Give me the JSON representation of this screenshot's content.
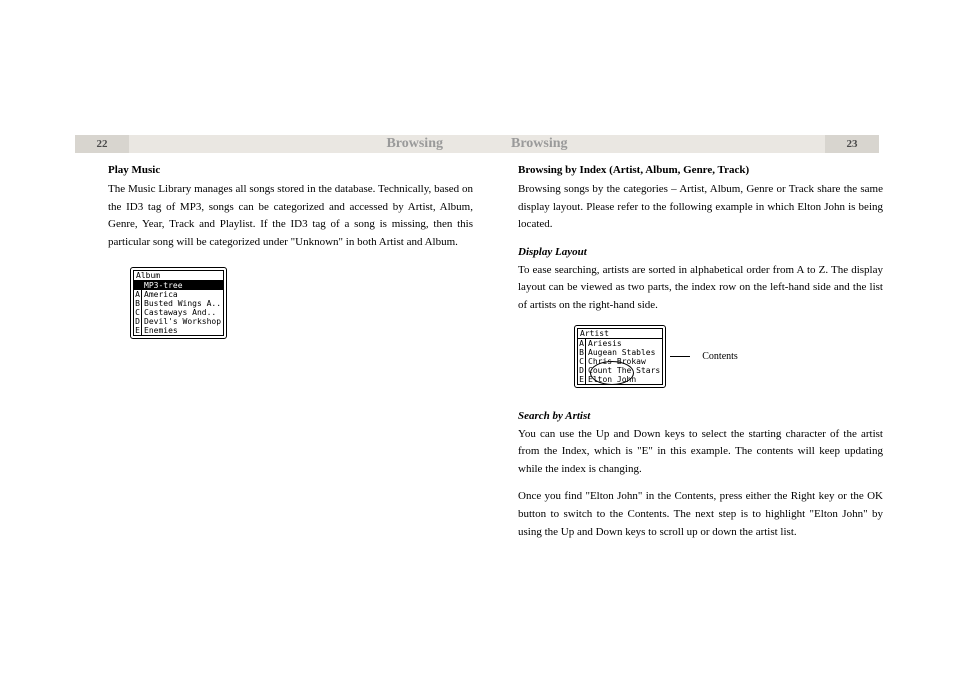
{
  "header": {
    "left_page_number": "22",
    "left_title": "Browsing",
    "right_title": "Browsing",
    "right_page_number": "23"
  },
  "left": {
    "heading": "Play Music",
    "p1": "The Music Library manages all songs stored in the database. Technically, based on the ID3 tag of MP3, songs can be categorized and accessed by Artist, Album, Genre, Year, Track and Playlist.  If the ID3 tag of  a song is missing, then this particular song will be categorized under \"Unknown\" in both Artist and Album.",
    "lcd": {
      "title": "Album",
      "rows": [
        {
          "idx": "",
          "val": "MP3-tree",
          "sel": true
        },
        {
          "idx": "A",
          "val": "America"
        },
        {
          "idx": "B",
          "val": "Busted Wings A.."
        },
        {
          "idx": "C",
          "val": "Castaways And.."
        },
        {
          "idx": "D",
          "val": "Devil's Workshop"
        },
        {
          "idx": "E",
          "val": "Enemies"
        }
      ]
    }
  },
  "right": {
    "heading": "Browsing by Index (Artist, Album, Genre, Track)",
    "p1": "Browsing songs by the categories – Artist, Album, Genre or Track share the same display layout.  Please refer to the following example in which Elton John is being located.",
    "sub1": "Display Layout",
    "p2": "To ease searching, artists are sorted in alphabetical order from A to Z.  The display layout can be viewed as two parts, the index row on the left-hand side and the list of artists on the right-hand side.",
    "lcd": {
      "title": "Artist",
      "rows": [
        {
          "idx": "A",
          "val": "Ariesis"
        },
        {
          "idx": "B",
          "val": "Augean Stables"
        },
        {
          "idx": "C",
          "val": "Chris Brokaw"
        },
        {
          "idx": "D",
          "val": "Count The Stars"
        },
        {
          "idx": "E",
          "val": "Elton John"
        }
      ]
    },
    "contents_label": "Contents",
    "sub2": "Search by Artist",
    "p3": "You can use the Up and Down keys to select the starting character of the artist from the Index, which is \"E\" in this example.  The contents will keep updating while the index is changing.",
    "p4": "Once you find \"Elton John\" in the Contents, press either the Right key or the OK button to switch to the Contents.  The next step is to highlight \"Elton John\" by using the Up and Down keys to scroll up or down the artist list."
  }
}
